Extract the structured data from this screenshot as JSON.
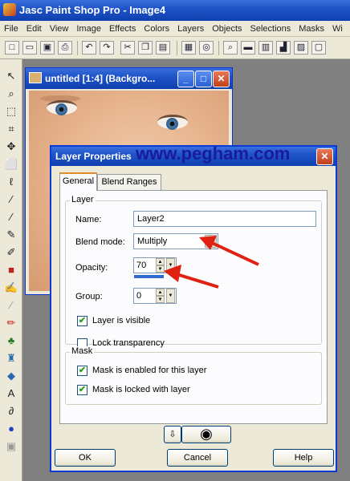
{
  "app": {
    "title": "Jasc Paint Shop Pro - Image4"
  },
  "menu": [
    "File",
    "Edit",
    "View",
    "Image",
    "Effects",
    "Colors",
    "Layers",
    "Objects",
    "Selections",
    "Masks",
    "Wi"
  ],
  "image_window": {
    "title": "untitled [1:4] (Backgro..."
  },
  "dialog": {
    "title": "Layer Properties",
    "watermark": "www.pegham.com",
    "tabs": [
      "General",
      "Blend Ranges"
    ],
    "layer_group": {
      "legend": "Layer",
      "name_label": "Name:",
      "name_value": "Layer2",
      "blend_label": "Blend mode:",
      "blend_value": "Multiply",
      "opacity_label": "Opacity:",
      "opacity_value": "70",
      "opacity_level": 0.7,
      "group_label": "Group:",
      "group_value": "0",
      "visible_label": "Layer is visible",
      "visible_checked": true,
      "lock_label": "Lock transparency",
      "lock_checked": false
    },
    "mask_group": {
      "legend": "Mask",
      "enabled_label": "Mask is enabled for this layer",
      "enabled_checked": true,
      "locked_label": "Mask is locked with layer",
      "locked_checked": true
    },
    "buttons": {
      "ok": "OK",
      "cancel": "Cancel",
      "help": "Help"
    }
  },
  "colors": {
    "titlebar": "#1f54c9",
    "dialog_bg": "#ece9d8",
    "arrow": "#e02010",
    "opacity_bar": "#2f6ad0"
  }
}
